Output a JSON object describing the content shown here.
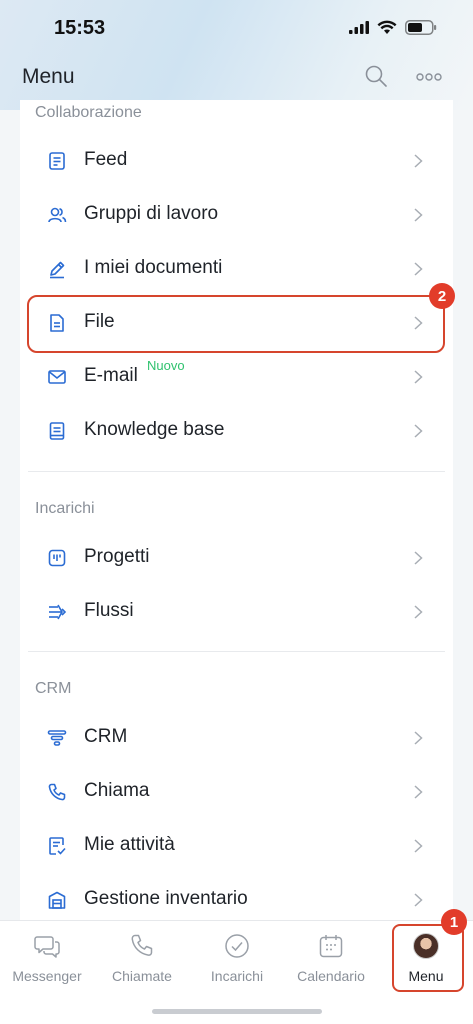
{
  "status": {
    "time": "15:53"
  },
  "header": {
    "title": "Menu"
  },
  "sections": [
    {
      "title": "Collaborazione",
      "items": [
        {
          "label": "Feed",
          "icon": "feed-icon"
        },
        {
          "label": "Gruppi di lavoro",
          "icon": "group-icon"
        },
        {
          "label": "I miei documenti",
          "icon": "pen-document-icon"
        },
        {
          "label": "File",
          "icon": "file-icon"
        },
        {
          "label": "E-mail",
          "icon": "mail-icon",
          "badge": "Nuovo"
        },
        {
          "label": "Knowledge base",
          "icon": "knowledge-base-icon"
        }
      ]
    },
    {
      "title": "Incarichi",
      "items": [
        {
          "label": "Progetti",
          "icon": "projects-icon"
        },
        {
          "label": "Flussi",
          "icon": "flows-icon"
        }
      ]
    },
    {
      "title": "CRM",
      "items": [
        {
          "label": "CRM",
          "icon": "crm-funnel-icon"
        },
        {
          "label": "Chiama",
          "icon": "phone-icon"
        },
        {
          "label": "Mie attività",
          "icon": "activity-icon"
        },
        {
          "label": "Gestione inventario",
          "icon": "inventory-icon"
        }
      ]
    }
  ],
  "callouts": {
    "file": "2",
    "menu": "1"
  },
  "tabs": [
    {
      "label": "Messenger",
      "icon": "chat-icon"
    },
    {
      "label": "Chiamate",
      "icon": "phone-icon"
    },
    {
      "label": "Incarichi",
      "icon": "check-circle-icon"
    },
    {
      "label": "Calendario",
      "icon": "calendar-icon"
    },
    {
      "label": "Menu",
      "icon": "avatar"
    }
  ],
  "colors": {
    "accent": "#2b6cd3",
    "highlight": "#d6452d",
    "new_badge": "#2fc26e"
  }
}
